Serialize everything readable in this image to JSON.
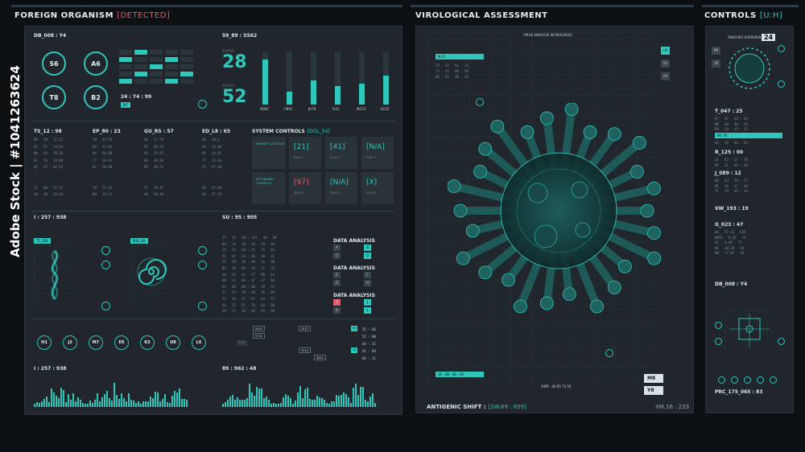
{
  "watermark": "Adobe Stock | #1041263624",
  "left": {
    "title": "FOREIGN ORGANISM",
    "status": "[DETECTED]",
    "s1": "DB_008 : Y4",
    "s2": "59_89 : S562",
    "rings": [
      "S6",
      "A6",
      "T8",
      "B2"
    ],
    "timer": "24 : 74 : 99",
    "timer_tag": "M7",
    "status_a": "28",
    "status_b": "52",
    "bars": [
      {
        "label": "Q087",
        "level": 0.85
      },
      {
        "label": "C891",
        "level": 0.25
      },
      {
        "label": "JH78",
        "level": 0.45
      },
      {
        "label": "I521",
        "level": 0.35
      },
      {
        "label": "MG72",
        "level": 0.4
      },
      {
        "label": "K125",
        "level": 0.55
      }
    ],
    "cols": [
      "TS_12 : 98",
      "EP_80 : 23",
      "GU_RS : 57",
      "ED_L8 : 65"
    ],
    "system_controls": "SYSTEM CONTROLS",
    "system_tag": "[DOL_54]",
    "primary": "PRIMARY CONTROLS",
    "secondary": "SECONDARY CONTROLS",
    "cards": [
      "[21]",
      "[41]",
      "[N/A]",
      "[97]",
      "[N/A]",
      "[X]"
    ],
    "s3": "I : 257 : 938",
    "s4": "SU : 95 : 905",
    "data_analysis": "DATA ANALYSIS",
    "tags": [
      "T5_568",
      "M41_89"
    ],
    "dial_codes": [
      "H1",
      "J2",
      "M7",
      "E6",
      "K3",
      "U8",
      "L6"
    ],
    "s5": "I : 257 : 938",
    "s6": "89 : 962 : 48",
    "table_rows": [
      "48 : 123",
      "39 : 46",
      "20 : 48",
      "46 : 17",
      "38 : 38",
      "97 : 78",
      "26 : 98"
    ]
  },
  "center": {
    "title": "VIROLOGICAL ASSESSMENT",
    "subtitle": "VIRUS ANALYSIS IN PROGRESS",
    "shift_label": "ANTIGENIC SHIFT :",
    "shift_value": "[SW.69 : 659]",
    "code": "XM.16 : 233",
    "legend": [
      "M8",
      "Y8"
    ],
    "side_btns": [
      "L6",
      "S3",
      "A4"
    ]
  },
  "right": {
    "title": "CONTROLS",
    "tag": "[U:H]",
    "overview": "ANALYSIS OVERVIEW",
    "overview_num": "24",
    "s1": "T_047 : 25",
    "s2": "R_125 : 00",
    "s3": "J_089 : 12",
    "s4": "XW_193 : 19",
    "s5": "G_023 : 47",
    "s6": "DB_008 : Y4",
    "s7": "PRC_175_065 : 83",
    "side_btns": [
      "R6",
      "Y6"
    ]
  },
  "colors": {
    "accent": "#2fc7bc",
    "alert": "#e05a6c",
    "panel": "#20262b",
    "bg": "#0c1013"
  }
}
